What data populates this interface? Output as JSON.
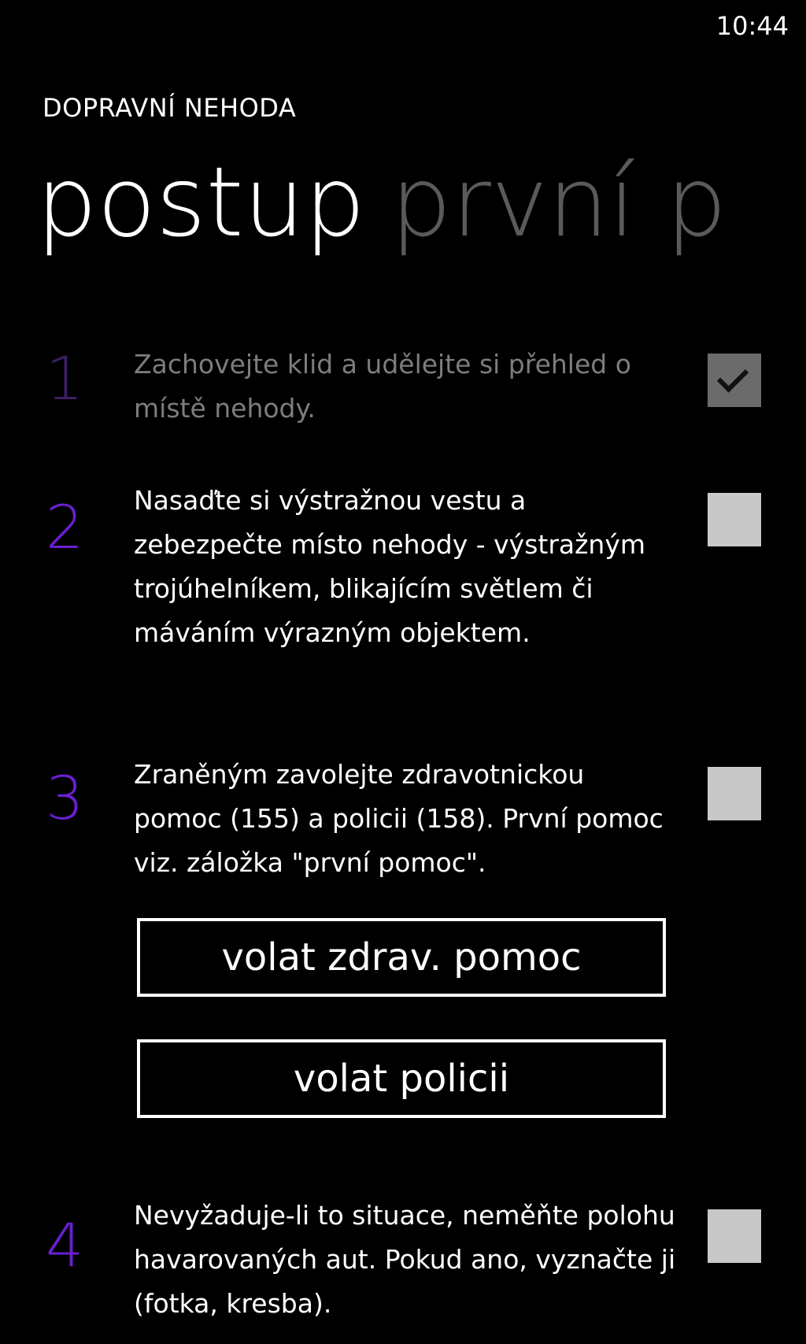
{
  "status": {
    "time": "10:44"
  },
  "app": {
    "title": "DOPRAVNÍ NEHODA"
  },
  "pivot": {
    "tabs": [
      {
        "label": "postup"
      },
      {
        "label": "první p"
      }
    ]
  },
  "steps": [
    {
      "number": "1",
      "text": "Zachovejte klid a udělejte si přehled o místě nehody.",
      "checked": true
    },
    {
      "number": "2",
      "text": "Nasaďte si výstražnou vestu a zebezpečte místo nehody - výstražným trojúhelníkem, blikajícím světlem či máváním výrazným objektem.",
      "checked": false
    },
    {
      "number": "3",
      "text": "Zraněným zavolejte zdravotnickou pomoc (155) a policii (158). První pomoc viz. záložka \"první pomoc\".",
      "checked": false
    },
    {
      "number": "4",
      "text": "Nevyžaduje-li to situace, neměňte polohu havarovaných aut. Pokud ano, vyznačte ji (fotka, kresba).",
      "checked": false
    }
  ],
  "buttons": {
    "call_medical": "volat zdrav. pomoc",
    "call_police": "volat policii"
  },
  "colors": {
    "accent": "#6a1fd1",
    "background": "#000000",
    "checkbox": "#c8c8c8",
    "checkbox_checked": "#6b6b6b"
  }
}
